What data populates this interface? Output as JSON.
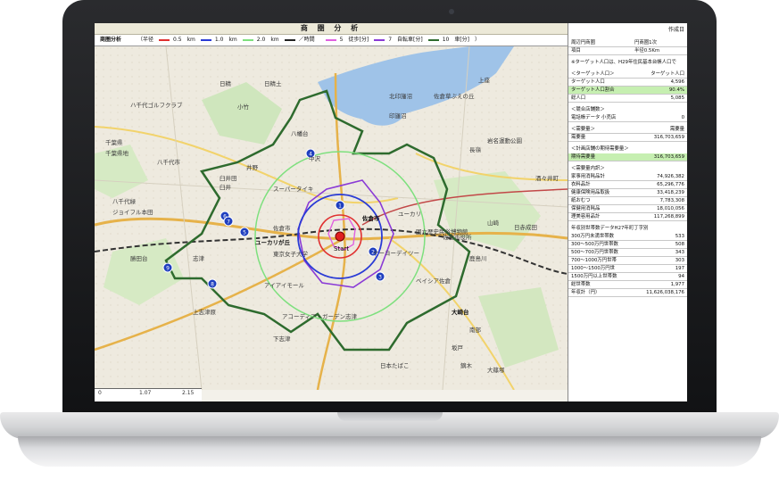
{
  "app": {
    "title": "商 圏 分 析",
    "created_label": "作成日"
  },
  "legend": {
    "heading": "商圏分析",
    "radius_label": "（半径",
    "items": [
      {
        "value": "0.5",
        "unit": "km",
        "color": "#e03030"
      },
      {
        "value": "1.0",
        "unit": "km",
        "color": "#2a3bd6"
      },
      {
        "value": "2.0",
        "unit": "km",
        "color": "#7ee07e"
      },
      {
        "value": "／時間",
        "unit": "",
        "color": "#222222"
      },
      {
        "value": "5",
        "unit": "徒歩[分]",
        "color": "#e060e0"
      },
      {
        "value": "7",
        "unit": "自転車[分]",
        "color": "#8a3ad6"
      },
      {
        "value": "10",
        "unit": "車[分]",
        "color": "#2e6b2e"
      }
    ],
    "closing": "）"
  },
  "map": {
    "start_label": "Start",
    "markers": [
      "1",
      "2",
      "3",
      "4",
      "5",
      "6",
      "7",
      "8",
      "9"
    ],
    "places": [
      "日精",
      "日精土",
      "北印旛沼",
      "ハ千代ゴルフクラブ",
      "千葉県",
      "千葉県地",
      "八千代市",
      "佐倉市",
      "酒々井町",
      "八千代緑",
      "ジョイフル本田",
      "勝田台",
      "臼井",
      "志津",
      "スーパータイキ",
      "佐倉市",
      "ユーカリが丘",
      "ユーカリ",
      "国立歴史民俗博物館",
      "佐倉市役所",
      "ケーヨーデイツー",
      "ベイシア佐倉",
      "東京女子大学",
      "アイアイモール",
      "アコーディア・ガーデン志津",
      "上志津原",
      "下志津",
      "小竹",
      "八幡台",
      "井野",
      "臼井田",
      "中沢",
      "岩名運動公園",
      "長嶺",
      "上座",
      "印旛沼",
      "佐倉草ぶえの丘",
      "山崎",
      "大崎台",
      "日赤成田",
      "鹿島川",
      "南部",
      "坂戸",
      "鏑木",
      "大篠塚",
      "日本たばこ"
    ],
    "scale_ticks": [
      "0",
      "1.07",
      "2.15"
    ]
  },
  "sheet": {
    "created": "作成日",
    "rows": [
      {
        "a": "周辺円商圏",
        "b": "円商圏1次"
      },
      {
        "a": "項目",
        "b": "半径0.5Km"
      },
      {
        "a": "※ターゲット人口は、H29年住民基本台帳人口で",
        "b": ""
      },
      {
        "a": "＜ターゲット人口＞",
        "b": "ターゲット人口"
      },
      {
        "a": "ターゲット人口",
        "b": "4,596"
      },
      {
        "a": "ターゲット人口割合",
        "b": "90.4%"
      },
      {
        "a": "総人口",
        "b": "5,085"
      },
      {
        "a": "＜競合店舗数＞",
        "b": ""
      },
      {
        "a": "電話帳データ 小売店",
        "b": "0"
      },
      {
        "a": "＜需要量＞",
        "b": "需要量"
      },
      {
        "a": "需要量",
        "b": "316,703,659"
      },
      {
        "a": "＜計画店舗の期待需要量＞",
        "b": ""
      },
      {
        "a": "期待需要量",
        "b": "316,703,659"
      },
      {
        "a": "＜需要量内訳＞",
        "b": ""
      },
      {
        "a": "家事用消耗品計",
        "b": "74,926,382"
      },
      {
        "a": "衣料品計",
        "b": "65,296,776"
      },
      {
        "a": "健康保険用品取扱",
        "b": "33,418,239"
      },
      {
        "a": "紙おむつ",
        "b": "7,783,308"
      },
      {
        "a": "保健用消耗品",
        "b": "18,010,056"
      },
      {
        "a": "理美容用品計",
        "b": "117,268,899"
      },
      {
        "a": "年収別世帯数データH27年町丁字別",
        "b": ""
      },
      {
        "a": "300万円未満世帯数",
        "b": "533"
      },
      {
        "a": "300～500万円世帯数",
        "b": "508"
      },
      {
        "a": "500～700万円世帯数",
        "b": "343"
      },
      {
        "a": "700～1000万円世帯",
        "b": "303"
      },
      {
        "a": "1000～1500万円世",
        "b": "197"
      },
      {
        "a": "1500万円以上世帯数",
        "b": "94"
      },
      {
        "a": "総世帯数",
        "b": "1,977"
      },
      {
        "a": "年収計（円）",
        "b": "11,626,038,176"
      }
    ]
  }
}
